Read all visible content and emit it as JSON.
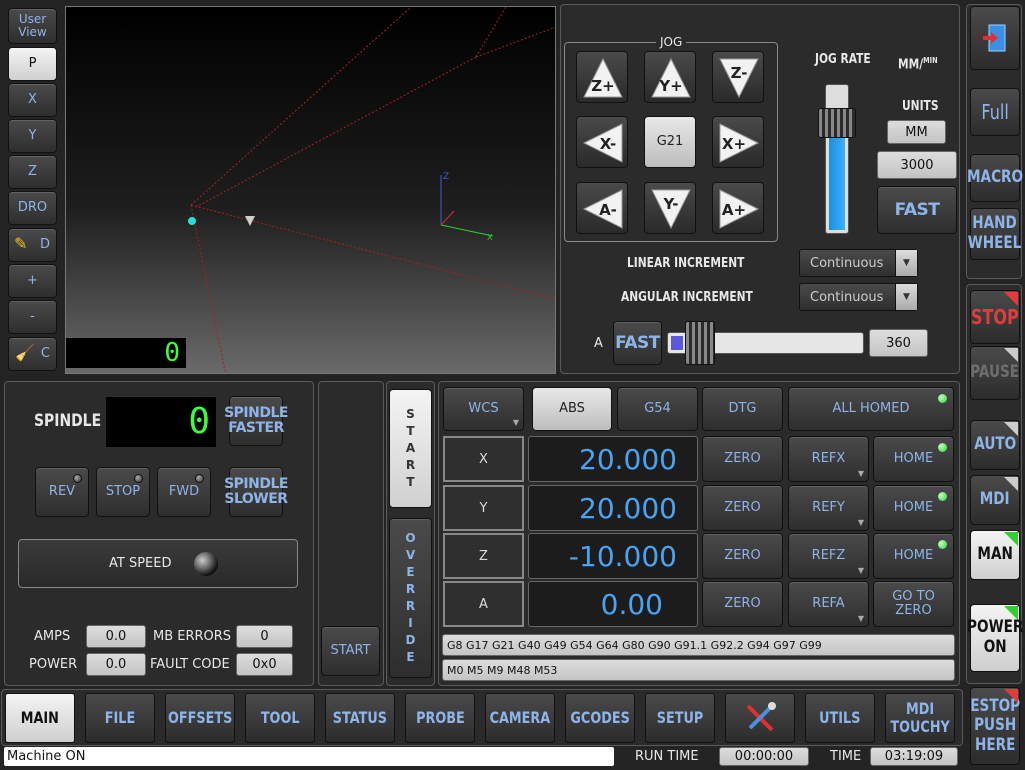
{
  "viewport": {
    "user_view_label": "User\nView",
    "view_buttons": [
      "P",
      "X",
      "Y",
      "Z",
      "DRO",
      "D",
      "+",
      "-",
      "C"
    ],
    "line_counter": "0"
  },
  "jog": {
    "title": "JOG",
    "buttons": [
      "Z+",
      "Y+",
      "Z-",
      "X-",
      "G21",
      "X+",
      "A-",
      "Y-",
      "A+"
    ],
    "rate_label": "JOG RATE",
    "units_display": "MM/MIN",
    "units_label": "UNITS",
    "units_value": "MM",
    "rate_value": "3000",
    "fast_label": "FAST",
    "jog_rate_percent": 75,
    "linear_increment_label": "LINEAR INCREMENT",
    "linear_increment_value": "Continuous",
    "angular_increment_label": "ANGULAR INCREMENT",
    "angular_increment_value": "Continuous",
    "a_label": "A",
    "a_fast_label": "FAST",
    "a_value": "360"
  },
  "right_top": {
    "full_label": "Full",
    "macro_label": "MACRO",
    "handwheel_label": "HAND\nWHEEL"
  },
  "right_ctrl": {
    "stop_label": "STOP",
    "pause_label": "PAUSE",
    "auto_label": "AUTO",
    "mdi_label": "MDI",
    "man_label": "MAN",
    "power_label": "POWER\nON",
    "estop_label": "ESTOP\nPUSH\nHERE"
  },
  "spindle": {
    "title": "SPINDLE",
    "rpm_display": "0",
    "faster_label": "SPINDLE\nFASTER",
    "slower_label": "SPINDLE\nSLOWER",
    "rev_label": "REV",
    "stop_label": "STOP",
    "fwd_label": "FWD",
    "at_speed_label": "AT SPEED",
    "amps_label": "AMPS",
    "amps_value": "0.0",
    "mb_errors_label": "MB ERRORS",
    "mb_errors_value": "0",
    "power_label": "POWER",
    "power_value": "0.0",
    "fault_code_label": "FAULT CODE",
    "fault_code_value": "0x0"
  },
  "cycle": {
    "start_label": "START",
    "start_vertical": [
      "S",
      "T",
      "A",
      "R",
      "T"
    ],
    "override_vertical": [
      "O",
      "V",
      "E",
      "R",
      "R",
      "I",
      "D",
      "E"
    ]
  },
  "dro": {
    "wcs_label": "WCS",
    "abs_label": "ABS",
    "g54_label": "G54",
    "dtg_label": "DTG",
    "all_homed_label": "ALL HOMED",
    "axes": [
      {
        "name": "X",
        "value": "20.000",
        "zero": "ZERO",
        "ref": "REFX",
        "home": "HOME"
      },
      {
        "name": "Y",
        "value": "20.000",
        "zero": "ZERO",
        "ref": "REFY",
        "home": "HOME"
      },
      {
        "name": "Z",
        "value": "-10.000",
        "zero": "ZERO",
        "ref": "REFZ",
        "home": "HOME"
      },
      {
        "name": "A",
        "value": "0.00",
        "zero": "ZERO",
        "ref": "REFA",
        "home": "GO TO\nZERO"
      }
    ],
    "gcodes": "G8 G17 G21 G40 G49 G54 G64 G80 G90 G91.1 G92.2 G94 G97 G99",
    "mcodes": "M0 M5 M9 M48 M53"
  },
  "nav": {
    "tabs": [
      "MAIN",
      "FILE",
      "OFFSETS",
      "TOOL",
      "STATUS",
      "PROBE",
      "CAMERA",
      "GCODES",
      "SETUP",
      "",
      "UTILS",
      "MDI\nTOUCHY"
    ]
  },
  "status": {
    "message": "Machine ON",
    "run_time_label": "RUN TIME",
    "run_time_value": "00:00:00",
    "time_label": "TIME",
    "time_value": "03:19:09"
  },
  "colors": {
    "accent_blue": "#8fb4e8",
    "dro_blue": "#4aa3f0",
    "led_green": "#2fd02f",
    "stop_red": "#e23b3b",
    "lcd_green": "#3cff3c"
  }
}
